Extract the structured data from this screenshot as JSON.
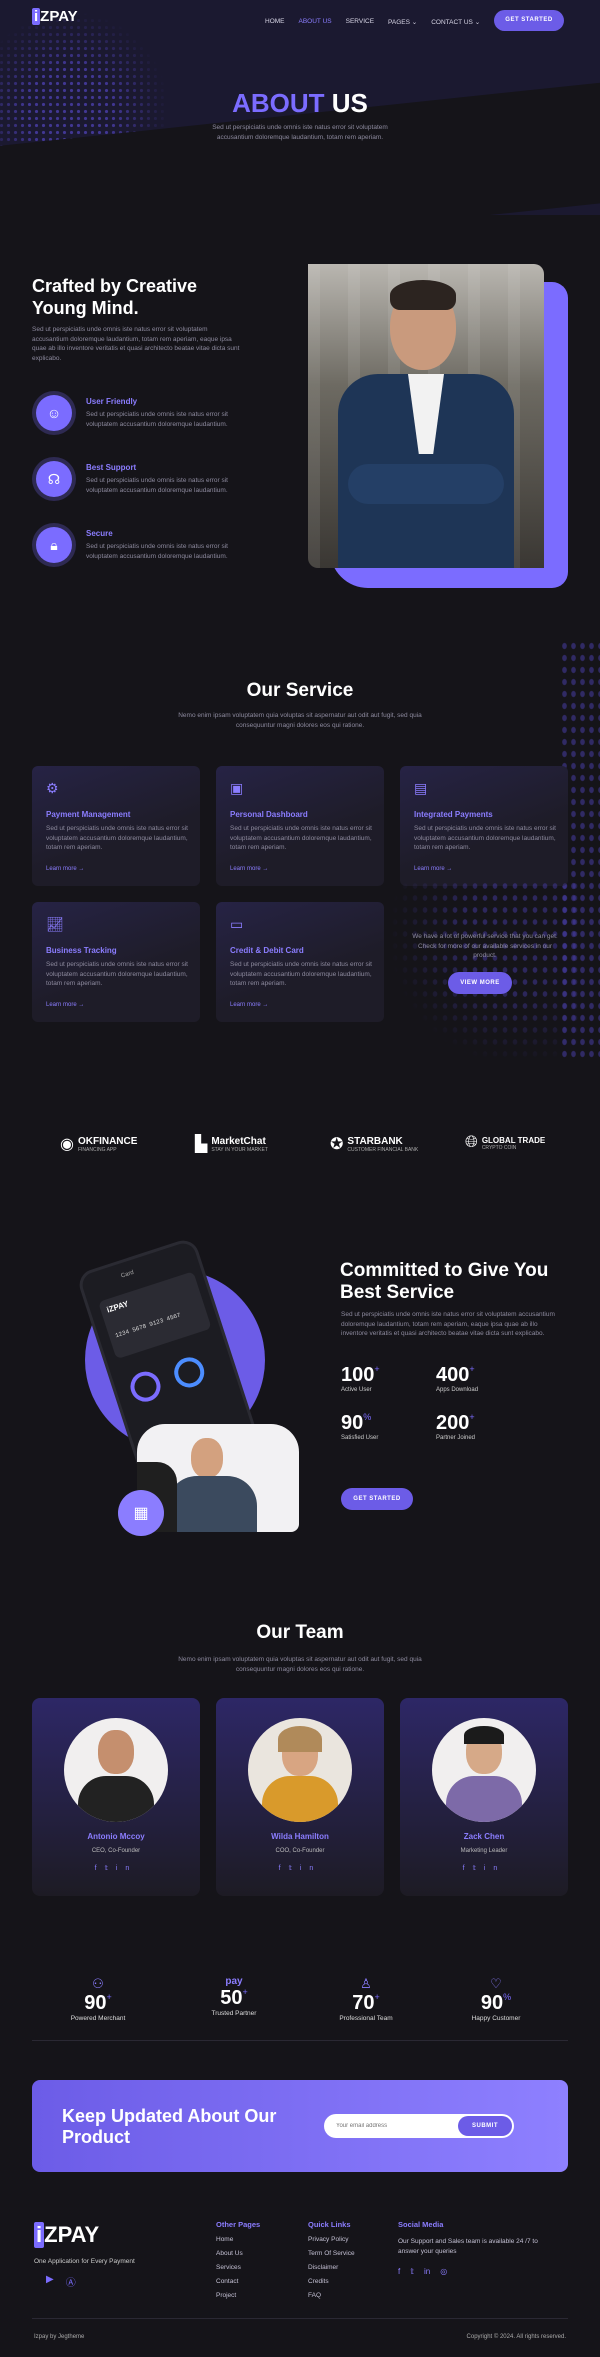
{
  "brand": {
    "logo_i": "i",
    "logo_rest": "ZPAY"
  },
  "nav": {
    "items": [
      "HOME",
      "ABOUT US",
      "SERVICE",
      "PAGES",
      "CONTACT US"
    ],
    "cta": "GET STARTED"
  },
  "hero": {
    "title_a": "ABOUT",
    "title_b": "US",
    "text": "Sed ut perspiciatis unde omnis iste natus error sit voluptatem accusantium doloremque laudantium, totam rem aperiam."
  },
  "about": {
    "title": "Crafted by Creative Young Mind.",
    "text": "Sed ut perspiciatis unde omnis iste natus error sit voluptatem accusantium doloremque laudantium, totam rem aperiam, eaque ipsa quae ab illo inventore veritatis et quasi architecto beatae vitae dicta sunt explicabo.",
    "features": [
      {
        "title": "User Friendly",
        "text": "Sed ut perspiciatis unde omnis iste natus error sit voluptatem accusantium doloremque laudantium.",
        "icon": "smile-icon"
      },
      {
        "title": "Best Support",
        "text": "Sed ut perspiciatis unde omnis iste natus error sit voluptatem accusantium doloremque laudantium.",
        "icon": "headset-icon"
      },
      {
        "title": "Secure",
        "text": "Sed ut perspiciatis unde omnis iste natus error sit voluptatem accusantium doloremque laudantium.",
        "icon": "lock-icon"
      }
    ]
  },
  "service": {
    "title": "Our Service",
    "text": "Nemo enim ipsam voluptatem quia voluptas sit aspernatur aut odit aut fugit, sed quia consequuntur magni dolores eos qui ratione.",
    "cards": [
      {
        "title": "Payment Management",
        "text": "Sed ut perspiciatis unde omnis iste natus error sit voluptatem accusantium doloremque laudantium, totam rem aperiam.",
        "link": "Learn more →"
      },
      {
        "title": "Personal Dashboard",
        "text": "Sed ut perspiciatis unde omnis iste natus error sit voluptatem accusantium doloremque laudantium, totam rem aperiam.",
        "link": "Learn more →"
      },
      {
        "title": "Integrated Payments",
        "text": "Sed ut perspiciatis unde omnis iste natus error sit voluptatem accusantium doloremque laudantium, totam rem aperiam.",
        "link": "Learn more →"
      },
      {
        "title": "Business Tracking",
        "text": "Sed ut perspiciatis unde omnis iste natus error sit voluptatem accusantium doloremque laudantium, totam rem aperiam.",
        "link": "Learn more →"
      },
      {
        "title": "Credit & Debit Card",
        "text": "Sed ut perspiciatis unde omnis iste natus error sit voluptatem accusantium doloremque laudantium, totam rem aperiam.",
        "link": "Learn more →"
      }
    ],
    "more_text": "We have a lot of powerful service that you can get. Check for more of our available services in our product.",
    "more_btn": "VIEW MORE"
  },
  "brands": [
    {
      "name": "OKFINANCE",
      "sub": "FINANCING APP"
    },
    {
      "name": "MarketChat",
      "sub": "STAY IN YOUR MARKET"
    },
    {
      "name": "STARBANK",
      "sub": "CUSTOMER FINANCIAL BANK"
    },
    {
      "name": "GLOBAL TRADE",
      "sub": "CRYPTO COIN"
    }
  ],
  "commit": {
    "title": "Committed to Give You Best Service",
    "text": "Sed ut perspiciatis unde omnis iste natus error sit voluptatem accusantium doloremque laudantium, totam rem aperiam, eaque ipsa quae ab illo inventore veritatis et quasi architecto beatae vitae dicta sunt explicabo.",
    "stats": [
      {
        "n": "100",
        "s": "+",
        "l": "Active User"
      },
      {
        "n": "400",
        "s": "+",
        "l": "Apps Download"
      },
      {
        "n": "90",
        "s": "%",
        "l": "Satisfied User"
      },
      {
        "n": "200",
        "s": "+",
        "l": "Partner Joined"
      }
    ],
    "btn": "GET STARTED",
    "phone": {
      "card_num": "1234 5678 9123 4567",
      "title": "Card"
    }
  },
  "team": {
    "title": "Our Team",
    "text": "Nemo enim ipsam voluptatem quia voluptas sit aspernatur aut odit aut fugit, sed quia consequuntur magni dolores eos qui ratione.",
    "members": [
      {
        "name": "Antonio Mccoy",
        "role": "CEO, Co-Founder"
      },
      {
        "name": "Wilda Hamilton",
        "role": "COO, Co-Founder"
      },
      {
        "name": "Zack Chen",
        "role": "Marketing Leader"
      }
    ]
  },
  "counters": [
    {
      "n": "90",
      "s": "+",
      "l": "Powered Merchant"
    },
    {
      "n": "50",
      "s": "+",
      "l": "Trusted Partner"
    },
    {
      "n": "70",
      "s": "+",
      "l": "Professional Team"
    },
    {
      "n": "90",
      "s": "%",
      "l": "Happy Customer"
    }
  ],
  "newsletter": {
    "title": "Keep Updated About Our Product",
    "placeholder": "Your email address",
    "btn": "SUBMIT"
  },
  "footer": {
    "tagline": "One Application for Every Payment",
    "col1": {
      "title": "Other Pages",
      "links": [
        "Home",
        "About Us",
        "Services",
        "Contact",
        "Project"
      ]
    },
    "col2": {
      "title": "Quick Links",
      "links": [
        "Privacy Policy",
        "Term Of Service",
        "Disclaimer",
        "Credits",
        "FAQ"
      ]
    },
    "col3": {
      "title": "Social Media",
      "text": "Our Support and Sales team is available 24 /7 to answer your queries"
    },
    "credit": "Izpay by Jegtheme",
    "copyright": "Copyright © 2024. All rights reserved."
  },
  "colors": {
    "accent": "#7b6cff",
    "bg": "#151419"
  }
}
